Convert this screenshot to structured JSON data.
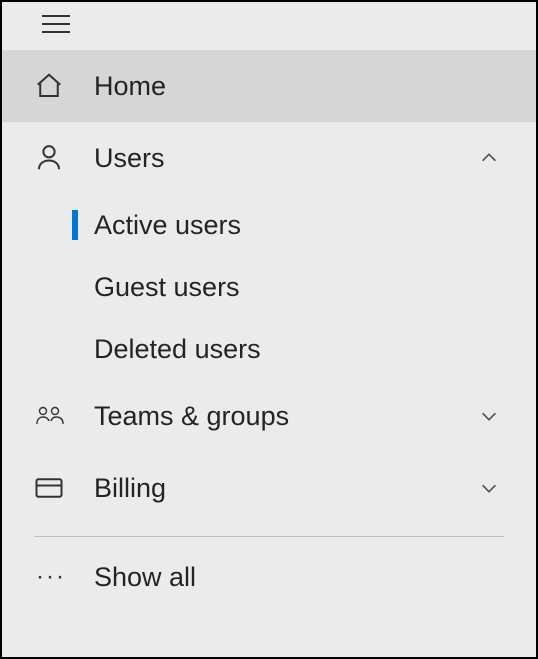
{
  "nav": {
    "home": {
      "label": "Home"
    },
    "users": {
      "label": "Users",
      "children": {
        "active": {
          "label": "Active users"
        },
        "guest": {
          "label": "Guest users"
        },
        "deleted": {
          "label": "Deleted users"
        }
      }
    },
    "teams": {
      "label": "Teams & groups"
    },
    "billing": {
      "label": "Billing"
    },
    "showall": {
      "label": "Show all"
    }
  }
}
